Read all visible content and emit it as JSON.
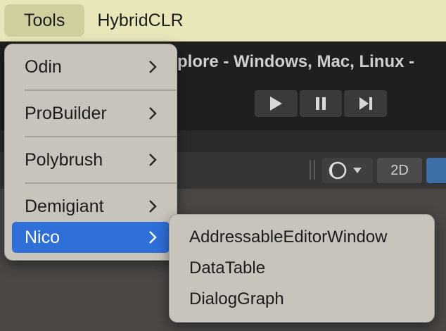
{
  "menubar": {
    "tools_label": "Tools",
    "hybridclr_label": "HybridCLR"
  },
  "editor": {
    "window_title": "plore - Windows, Mac, Linux -",
    "toolbar": {
      "two_d_label": "2D"
    }
  },
  "tools_menu": {
    "items": [
      {
        "label": "Odin"
      },
      {
        "label": "ProBuilder"
      },
      {
        "label": "Polybrush"
      },
      {
        "label": "Demigiant"
      },
      {
        "label": "Nico"
      }
    ],
    "selected": "Nico"
  },
  "nico_submenu": {
    "items": [
      {
        "label": "AddressableEditorWindow"
      },
      {
        "label": "DataTable"
      },
      {
        "label": "DialogGraph"
      }
    ]
  },
  "colors": {
    "selection_blue": "#2f6fd8",
    "menubar_bg": "#e9e6b9",
    "dropdown_bg": "#c9c4bb"
  }
}
